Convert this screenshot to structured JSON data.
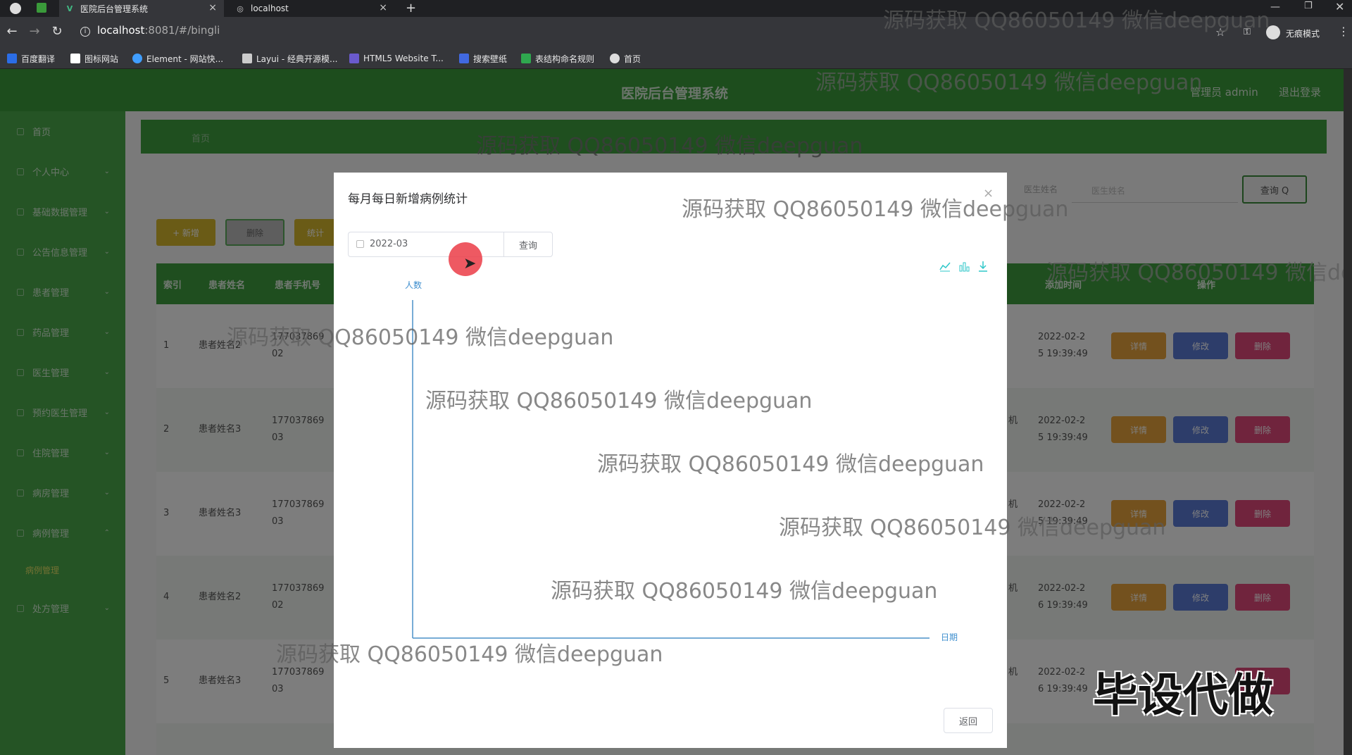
{
  "browser": {
    "tabs": [
      {
        "label": "医院后台管理系统",
        "active": true
      },
      {
        "label": "localhost",
        "active": false
      }
    ],
    "url_host": "localhost",
    "url_path": ":8081/#/bingli",
    "incognito_label": "无痕模式",
    "bookmarks": [
      {
        "label": "百度翻译",
        "color": "#2b6de6"
      },
      {
        "label": "图标网站",
        "color": "#ffffff"
      },
      {
        "label": "Element - 网站快...",
        "color": "#409eff"
      },
      {
        "label": "Layui - 经典开源模...",
        "color": "#cccccc"
      },
      {
        "label": "HTML5 Website T...",
        "color": "#6a5acd"
      },
      {
        "label": "搜索壁纸",
        "color": "#4169e1"
      },
      {
        "label": "表结构命名规则",
        "color": "#2fa84f"
      },
      {
        "label": "首页",
        "color": "#dddddd"
      }
    ]
  },
  "app": {
    "title": "医院后台管理系统",
    "user_label": "管理员 admin",
    "logout_label": "退出登录",
    "sidebar": [
      {
        "label": "首页",
        "has_sub": false
      },
      {
        "label": "个人中心",
        "has_sub": true
      },
      {
        "label": "基础数据管理",
        "has_sub": true
      },
      {
        "label": "公告信息管理",
        "has_sub": true
      },
      {
        "label": "患者管理",
        "has_sub": true
      },
      {
        "label": "药品管理",
        "has_sub": true
      },
      {
        "label": "医生管理",
        "has_sub": true
      },
      {
        "label": "预约医生管理",
        "has_sub": true
      },
      {
        "label": "住院管理",
        "has_sub": true
      },
      {
        "label": "病房管理",
        "has_sub": true
      },
      {
        "label": "病例管理",
        "has_sub": true
      },
      {
        "label": "处方管理",
        "has_sub": true
      }
    ],
    "sidebar_subitem": "病例管理",
    "crumb": "首页",
    "toolbar": {
      "add": "+ 新增",
      "delete": "删除",
      "stats": "统计"
    },
    "search": {
      "label": "医生姓名",
      "placeholder": "医生姓名",
      "button": "查询 Q"
    },
    "table": {
      "headers": [
        "索引",
        "患者姓名",
        "患者手机号",
        "添加时间",
        "操作"
      ],
      "rows": [
        {
          "index": "1",
          "name": "患者姓名2",
          "phone_a": "177037869",
          "phone_b": "02",
          "time_a": "2022-02-2",
          "time_b": "5 19:39:49",
          "extra": ""
        },
        {
          "index": "2",
          "name": "患者姓名3",
          "phone_a": "177037869",
          "phone_b": "03",
          "time_a": "2022-02-2",
          "time_b": "5 19:39:49",
          "extra": "机"
        },
        {
          "index": "3",
          "name": "患者姓名3",
          "phone_a": "177037869",
          "phone_b": "03",
          "time_a": "2022-02-2",
          "time_b": "5 19:39:49",
          "extra": "机"
        },
        {
          "index": "4",
          "name": "患者姓名2",
          "phone_a": "177037869",
          "phone_b": "02",
          "time_a": "2022-02-2",
          "time_b": "6 19:39:49",
          "extra": "机"
        },
        {
          "index": "5",
          "name": "患者姓名3",
          "phone_a": "177037869",
          "phone_b": "03",
          "time_a": "2022-02-2",
          "time_b": "6 19:39:49",
          "extra": "机"
        }
      ],
      "row_buttons": {
        "detail": "详情",
        "edit": "修改",
        "delete": "删除"
      }
    }
  },
  "dialog": {
    "title": "每月每日新增病例统计",
    "date_value": "2022-03",
    "query_button": "查询",
    "back_button": "返回",
    "tools": [
      "line-chart-icon",
      "bar-chart-icon",
      "download-icon"
    ]
  },
  "chart_data": {
    "type": "line",
    "title": "",
    "ylabel": "人数",
    "xlabel": "日期",
    "x": [],
    "series": [],
    "grid": false
  },
  "watermarks": [
    "源码获取 QQ86050149 微信deepguan",
    "源码获取 QQ86050149 微信deepguan",
    "源码获取 QQ86050149 微信deepguan",
    "源码获取 QQ86050149 微信deepguan",
    "源码获取 QQ86050149 微信dee",
    "源码获取 QQ86050149 微信deepguan",
    "源码获取 QQ86050149 微信deepguan",
    "源码获取 QQ86050149 微信deepguan",
    "源码获取 QQ86050149 微信deepguan",
    "源码获取 QQ86050149 微信deepguan",
    "源码获取 QQ86050149 微信deepguan"
  ],
  "stamp": "毕设代做",
  "colors": {
    "primary": "#3a9a3a",
    "detail": "#e6a23c",
    "edit": "#5b7bd5",
    "delete": "#e0487a"
  }
}
